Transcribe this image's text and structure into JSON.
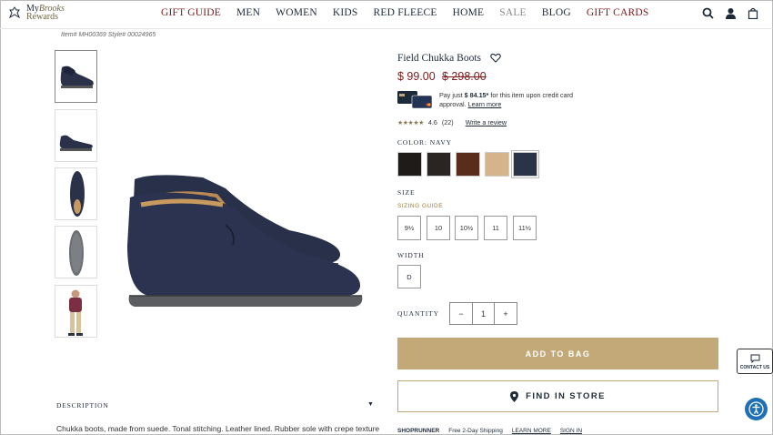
{
  "header": {
    "logo_line1": "My",
    "logo_line1_b": "Brooks",
    "logo_line2": "Rewards",
    "nav": [
      {
        "label": "GIFT GUIDE",
        "style": "red"
      },
      {
        "label": "MEN",
        "style": "dark"
      },
      {
        "label": "WOMEN",
        "style": "dark"
      },
      {
        "label": "KIDS",
        "style": "dark"
      },
      {
        "label": "RED FLEECE",
        "style": "dark"
      },
      {
        "label": "HOME",
        "style": "dark"
      },
      {
        "label": "SALE",
        "style": "grey"
      },
      {
        "label": "BLOG",
        "style": "dark"
      },
      {
        "label": "GIFT CARDS",
        "style": "red"
      }
    ],
    "icons": [
      "search-icon",
      "account-icon",
      "bag-icon"
    ]
  },
  "item_info": "Item# MH00369 Style# 00024965",
  "thumbnails": [
    "side-view",
    "side-view-small",
    "top-view",
    "sole-view",
    "model-view"
  ],
  "product": {
    "title": "Field Chukka Boots",
    "price": "$ 99.00",
    "old_price": "$ 298.00",
    "cc_pay_just": "Pay just ",
    "cc_amount": "$ 84.15*",
    "cc_rest": " for this item upon credit card approval. ",
    "cc_learn": "Learn more",
    "stars": "★★★★★",
    "rating": "4.6",
    "reviews": "(22)",
    "write_review": "Write a review",
    "color_label": "COLOR:",
    "color_value": "NAVY",
    "colors": [
      "#1e1b19",
      "#2a2522",
      "#5a2c1c",
      "#d6b48b",
      "#2b3346"
    ],
    "size_label": "SIZE",
    "sizing_guide": "SIZING GUIDE",
    "sizes": [
      "9½",
      "10",
      "10½",
      "11",
      "11½"
    ],
    "width_label": "WIDTH",
    "width_value": "D",
    "quantity_label": "QUANTITY",
    "qty_minus": "−",
    "qty_value": "1",
    "qty_plus": "+",
    "add_to_bag": "ADD TO BAG",
    "find_in_store": "FIND IN STORE",
    "shoprunner": "SHOPRUNNER",
    "shipping": "Free 2-Day Shipping",
    "learn_more": "LEARN MORE",
    "sign_in": "SIGN IN"
  },
  "description": {
    "heading": "DESCRIPTION",
    "text": "Chukka boots, made from suede. Tonal stitching. Leather lined. Rubber sole with crepe texture"
  },
  "contact": "CONTACT US"
}
